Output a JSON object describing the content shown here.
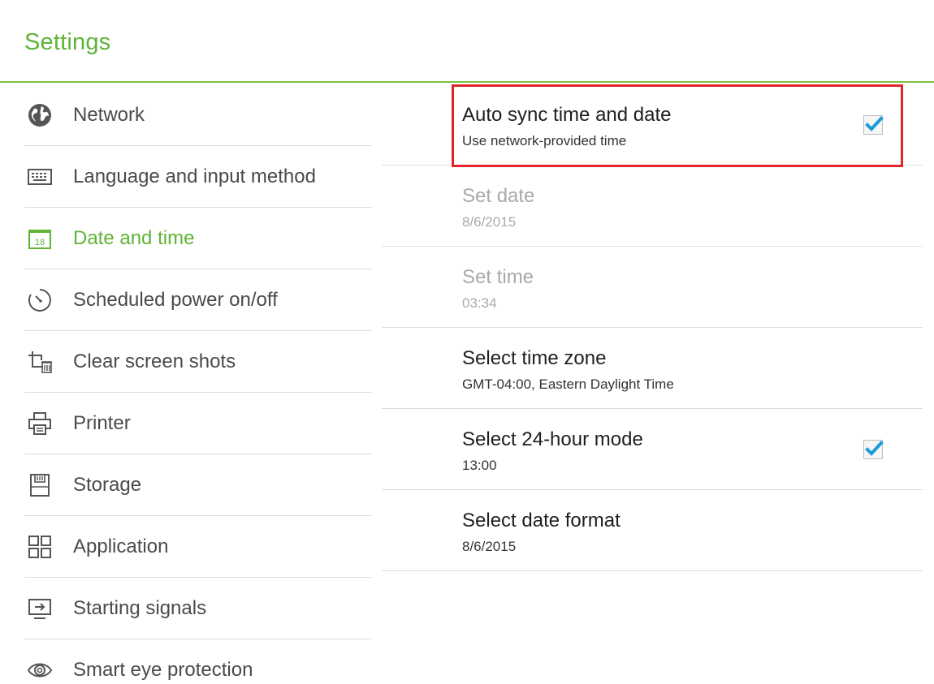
{
  "header": {
    "title": "Settings"
  },
  "sidebar": {
    "items": [
      {
        "label": "Network",
        "icon": "globe-icon"
      },
      {
        "label": "Language and input method",
        "icon": "keyboard-icon"
      },
      {
        "label": "Date and time",
        "icon": "calendar-icon",
        "active": true,
        "icon_text": "18"
      },
      {
        "label": "Scheduled power on/off",
        "icon": "timer-icon"
      },
      {
        "label": "Clear screen shots",
        "icon": "crop-trash-icon"
      },
      {
        "label": "Printer",
        "icon": "printer-icon"
      },
      {
        "label": "Storage",
        "icon": "storage-icon"
      },
      {
        "label": "Application",
        "icon": "apps-grid-icon"
      },
      {
        "label": "Starting signals",
        "icon": "input-signal-icon"
      },
      {
        "label": "Smart eye protection",
        "icon": "eye-icon"
      }
    ]
  },
  "main": {
    "rows": [
      {
        "title": "Auto sync time and date",
        "subtitle": "Use network-provided time",
        "checked": true,
        "enabled": true
      },
      {
        "title": "Set date",
        "subtitle": "8/6/2015",
        "enabled": false
      },
      {
        "title": "Set time",
        "subtitle": "03:34",
        "enabled": false
      },
      {
        "title": "Select time zone",
        "subtitle": "GMT-04:00, Eastern Daylight Time",
        "enabled": true
      },
      {
        "title": "Select 24-hour mode",
        "subtitle": "13:00",
        "checked": true,
        "enabled": true
      },
      {
        "title": "Select date format",
        "subtitle": "8/6/2015",
        "enabled": true
      }
    ]
  },
  "colors": {
    "accent_green": "#5fb336",
    "divider": "#dcdcdc",
    "check_blue": "#1e9bd7",
    "highlight_red": "#e3242b"
  }
}
